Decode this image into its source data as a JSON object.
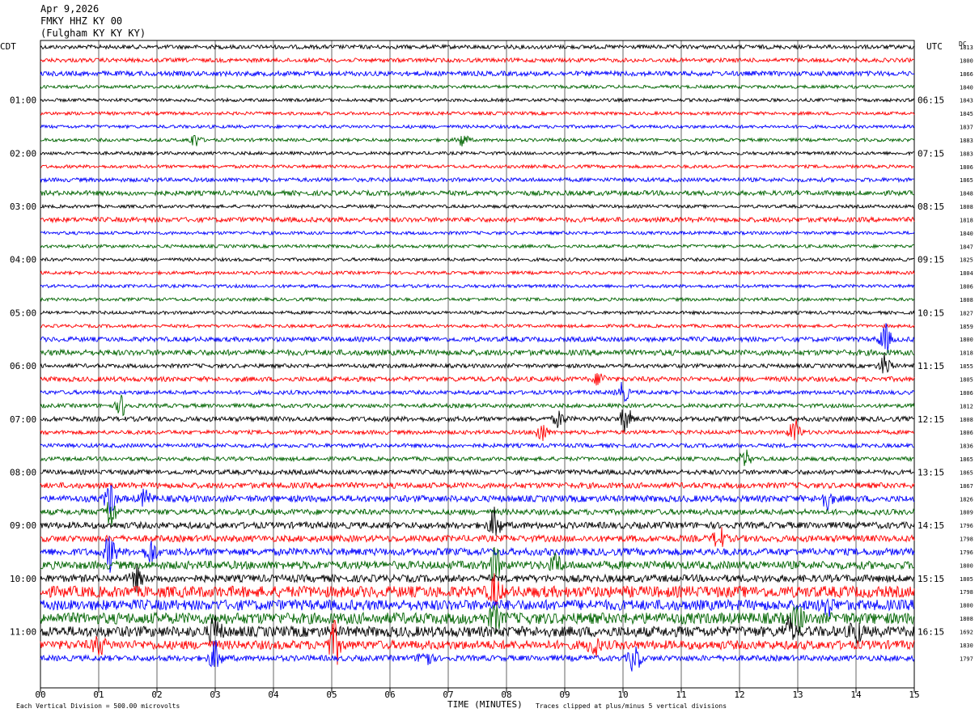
{
  "header": {
    "date": "Apr 9,2026",
    "station": "FMKY HHZ KY 00",
    "location": "(Fulgham KY KY KY)"
  },
  "colors": {
    "trace_cycle": [
      "#000000",
      "#ff0000",
      "#0000ff",
      "#006400"
    ],
    "grid": "#000000",
    "background": "#ffffff"
  },
  "chart_data": {
    "type": "line",
    "subtype": "helicorder",
    "left_timezone": "CDT",
    "right_timezone": "UTC",
    "right_column_title": "DC",
    "xlabel": "TIME (MINUTES)",
    "xlim": [
      0,
      15
    ],
    "x_ticks": [
      "00",
      "01",
      "02",
      "03",
      "04",
      "05",
      "06",
      "07",
      "08",
      "09",
      "10",
      "11",
      "12",
      "13",
      "14",
      "15"
    ],
    "minutes_per_line": 15,
    "left_time_labels": [
      "01:00",
      "02:00",
      "03:00",
      "04:00",
      "05:00",
      "06:00",
      "07:00",
      "08:00",
      "09:00",
      "10:00",
      "11:00"
    ],
    "right_time_labels": [
      "06:15",
      "07:15",
      "08:15",
      "09:15",
      "10:15",
      "11:15",
      "12:15",
      "13:15",
      "14:15",
      "15:15",
      "16:15"
    ],
    "dc_offsets": [
      "1813",
      "1800",
      "1866",
      "1840",
      "1843",
      "1845",
      "1837",
      "1883",
      "1883",
      "1806",
      "1865",
      "1848",
      "1808",
      "1818",
      "1840",
      "1847",
      "1825",
      "1804",
      "1806",
      "1808",
      "1827",
      "1859",
      "1800",
      "1818",
      "1855",
      "1805",
      "1806",
      "1812",
      "1808",
      "1806",
      "1836",
      "1865",
      "1865",
      "1867",
      "1826",
      "1809",
      "1796",
      "1798",
      "1796",
      "1800",
      "1805",
      "1798",
      "1800",
      "1808",
      "1692",
      "1830",
      "1797"
    ],
    "series": [
      {
        "trace": 0,
        "amplitude": 2.5,
        "events": []
      },
      {
        "trace": 1,
        "amplitude": 2.5,
        "events": []
      },
      {
        "trace": 2,
        "amplitude": 3.0,
        "events": []
      },
      {
        "trace": 3,
        "amplitude": 2.0,
        "events": []
      },
      {
        "trace": 4,
        "amplitude": 2.0,
        "events": []
      },
      {
        "trace": 5,
        "amplitude": 2.0,
        "events": []
      },
      {
        "trace": 6,
        "amplitude": 2.0,
        "events": []
      },
      {
        "trace": 7,
        "amplitude": 2.0,
        "events": [
          {
            "minute": 2.65,
            "amplitude": 8
          },
          {
            "minute": 7.25,
            "amplitude": 8
          }
        ]
      },
      {
        "trace": 8,
        "amplitude": 2.0,
        "events": []
      },
      {
        "trace": 9,
        "amplitude": 2.0,
        "events": []
      },
      {
        "trace": 10,
        "amplitude": 2.5,
        "events": []
      },
      {
        "trace": 11,
        "amplitude": 3.0,
        "events": []
      },
      {
        "trace": 12,
        "amplitude": 2.0,
        "events": []
      },
      {
        "trace": 13,
        "amplitude": 3.0,
        "events": []
      },
      {
        "trace": 14,
        "amplitude": 2.0,
        "events": []
      },
      {
        "trace": 15,
        "amplitude": 2.0,
        "events": []
      },
      {
        "trace": 16,
        "amplitude": 2.0,
        "events": []
      },
      {
        "trace": 17,
        "amplitude": 2.0,
        "events": []
      },
      {
        "trace": 18,
        "amplitude": 2.0,
        "events": []
      },
      {
        "trace": 19,
        "amplitude": 2.0,
        "events": []
      },
      {
        "trace": 20,
        "amplitude": 2.0,
        "events": []
      },
      {
        "trace": 21,
        "amplitude": 2.0,
        "events": []
      },
      {
        "trace": 22,
        "amplitude": 3.0,
        "events": [
          {
            "minute": 14.5,
            "amplitude": 18
          }
        ]
      },
      {
        "trace": 23,
        "amplitude": 3.5,
        "events": []
      },
      {
        "trace": 24,
        "amplitude": 2.5,
        "events": [
          {
            "minute": 14.5,
            "amplitude": 14
          }
        ]
      },
      {
        "trace": 25,
        "amplitude": 3.0,
        "events": [
          {
            "minute": 9.6,
            "amplitude": 8
          }
        ]
      },
      {
        "trace": 26,
        "amplitude": 2.5,
        "events": [
          {
            "minute": 10.0,
            "amplitude": 12
          }
        ]
      },
      {
        "trace": 27,
        "amplitude": 2.5,
        "events": [
          {
            "minute": 1.4,
            "amplitude": 12
          }
        ]
      },
      {
        "trace": 28,
        "amplitude": 3.0,
        "events": [
          {
            "minute": 8.9,
            "amplitude": 9
          },
          {
            "minute": 10.05,
            "amplitude": 16
          }
        ]
      },
      {
        "trace": 29,
        "amplitude": 2.5,
        "events": [
          {
            "minute": 8.6,
            "amplitude": 12
          },
          {
            "minute": 12.95,
            "amplitude": 16
          }
        ]
      },
      {
        "trace": 30,
        "amplitude": 2.5,
        "events": []
      },
      {
        "trace": 31,
        "amplitude": 2.5,
        "events": [
          {
            "minute": 12.1,
            "amplitude": 10
          }
        ]
      },
      {
        "trace": 32,
        "amplitude": 3.0,
        "events": []
      },
      {
        "trace": 33,
        "amplitude": 3.5,
        "events": []
      },
      {
        "trace": 34,
        "amplitude": 4.0,
        "events": [
          {
            "minute": 1.2,
            "amplitude": 18
          },
          {
            "minute": 1.8,
            "amplitude": 10
          },
          {
            "minute": 13.5,
            "amplitude": 12
          }
        ]
      },
      {
        "trace": 35,
        "amplitude": 3.5,
        "events": [
          {
            "minute": 1.2,
            "amplitude": 20
          }
        ]
      },
      {
        "trace": 36,
        "amplitude": 4.0,
        "events": [
          {
            "minute": 7.8,
            "amplitude": 20
          }
        ]
      },
      {
        "trace": 37,
        "amplitude": 4.0,
        "events": [
          {
            "minute": 11.65,
            "amplitude": 14
          }
        ]
      },
      {
        "trace": 38,
        "amplitude": 4.5,
        "events": [
          {
            "minute": 1.2,
            "amplitude": 22
          },
          {
            "minute": 1.9,
            "amplitude": 14
          }
        ]
      },
      {
        "trace": 39,
        "amplitude": 5.0,
        "events": [
          {
            "minute": 7.8,
            "amplitude": 22
          },
          {
            "minute": 8.85,
            "amplitude": 12
          }
        ]
      },
      {
        "trace": 40,
        "amplitude": 4.5,
        "events": [
          {
            "minute": 1.65,
            "amplitude": 14
          }
        ]
      },
      {
        "trace": 41,
        "amplitude": 7.0,
        "events": [
          {
            "minute": 7.8,
            "amplitude": 18
          }
        ]
      },
      {
        "trace": 42,
        "amplitude": 6.5,
        "events": [
          {
            "minute": 13.5,
            "amplitude": 14
          }
        ]
      },
      {
        "trace": 43,
        "amplitude": 7.0,
        "events": [
          {
            "minute": 7.8,
            "amplitude": 14
          },
          {
            "minute": 13.0,
            "amplitude": 14
          }
        ]
      },
      {
        "trace": 44,
        "amplitude": 6.5,
        "events": [
          {
            "minute": 3.0,
            "amplitude": 18
          },
          {
            "minute": 12.85,
            "amplitude": 14
          },
          {
            "minute": 14.0,
            "amplitude": 14
          }
        ]
      },
      {
        "trace": 45,
        "amplitude": 5.5,
        "events": [
          {
            "minute": 5.05,
            "amplitude": 26
          },
          {
            "minute": 1.0,
            "amplitude": 12
          },
          {
            "minute": 9.5,
            "amplitude": 12
          }
        ]
      },
      {
        "trace": 46,
        "amplitude": 3.5,
        "events": [
          {
            "minute": 3.0,
            "amplitude": 20
          },
          {
            "minute": 6.6,
            "amplitude": 14
          },
          {
            "minute": 10.2,
            "amplitude": 18
          }
        ]
      }
    ],
    "footer_left": "Each Vertical Division =  500.00 microvolts",
    "footer_right": "Traces clipped at plus/minus 5 vertical divisions"
  }
}
